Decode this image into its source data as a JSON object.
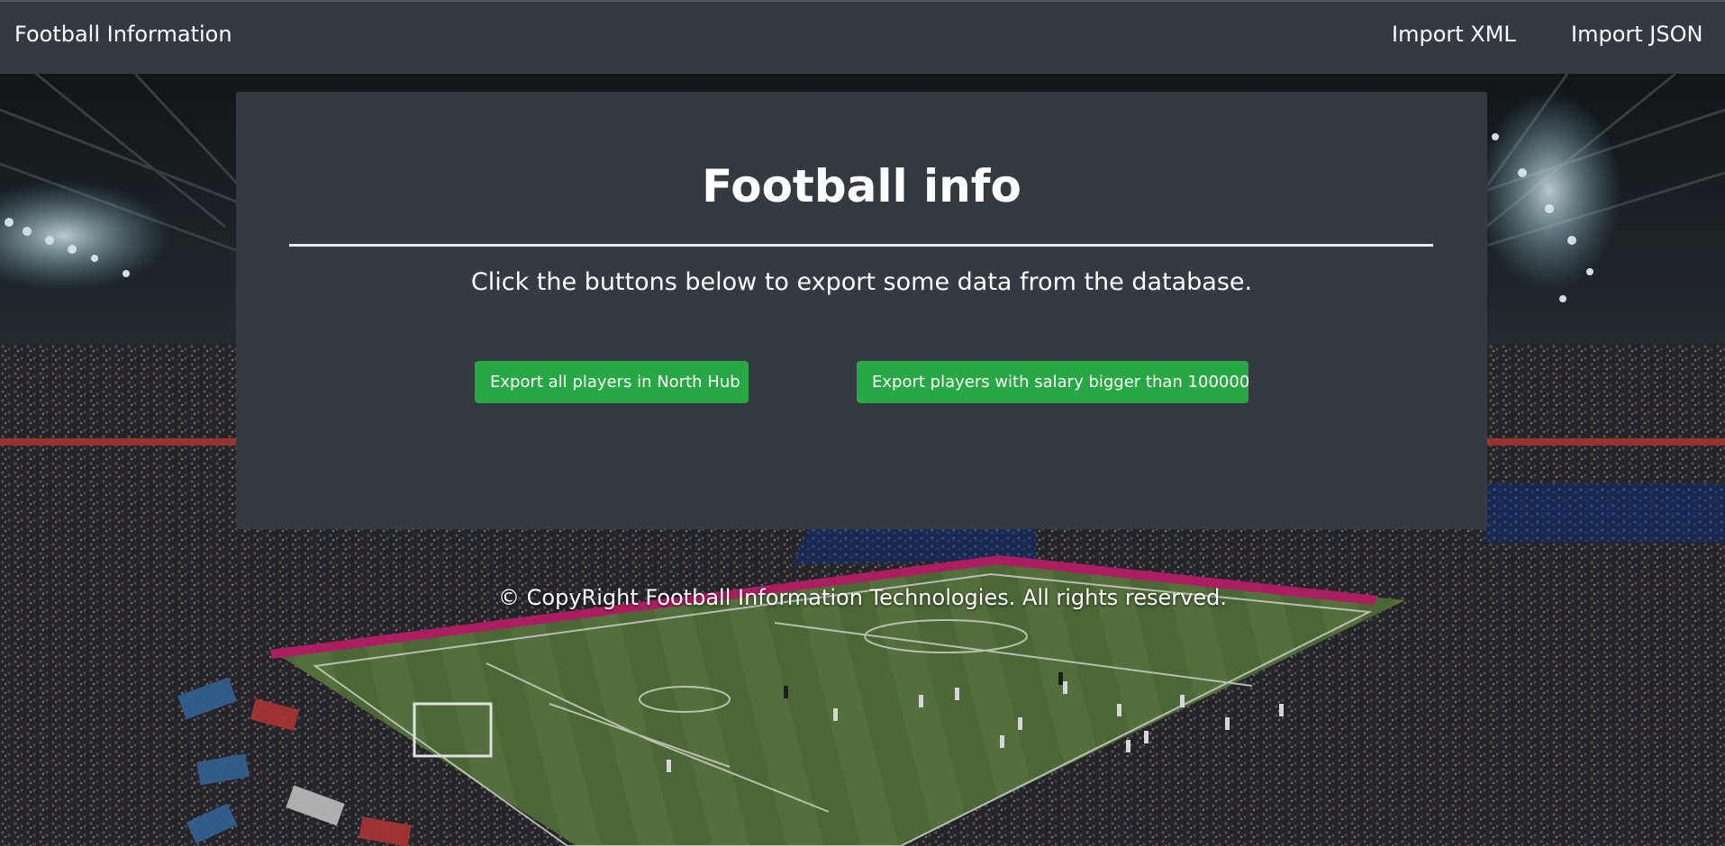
{
  "navbar": {
    "brand": "Football Information",
    "links": [
      "Import XML",
      "Import JSON"
    ]
  },
  "card": {
    "title": "Football info",
    "subtitle": "Click the buttons below to export some data from the database.",
    "buttons": [
      "Export all players in North Hub",
      "Export players with salary bigger than 100000"
    ]
  },
  "footer": {
    "text": "© CopyRight Football Information Technologies. All rights reserved."
  },
  "colors": {
    "navbar_bg": "#343a40",
    "card_bg": "#343a40",
    "button_bg": "#28a745",
    "text": "#ffffff"
  }
}
